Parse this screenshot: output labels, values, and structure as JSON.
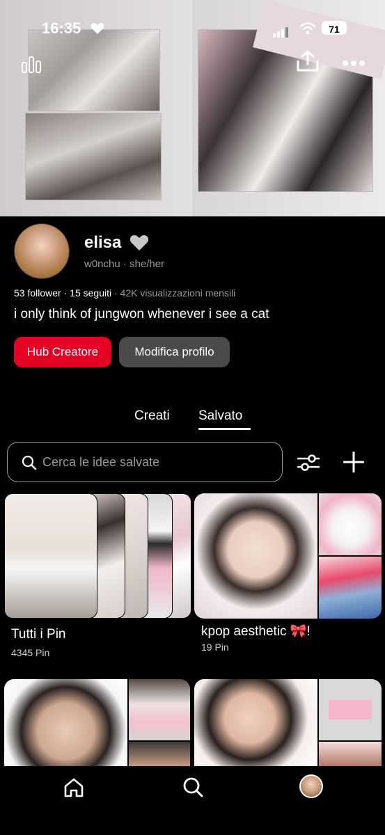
{
  "status_bar": {
    "time": "16:35",
    "battery": "71"
  },
  "profile": {
    "name": "elisa",
    "handle": "w0nchu · she/her",
    "followers": "53 follower",
    "following": "15 seguiti",
    "views": "42K visualizzazioni mensili",
    "bio": "i only think of jungwon whenever i see a cat",
    "hub_button": "Hub Creatore",
    "edit_button": "Modifica profilo"
  },
  "tabs": [
    {
      "label": "Creati",
      "active": false
    },
    {
      "label": "Salvato",
      "active": true
    }
  ],
  "search": {
    "placeholder": "Cerca le idee salvate"
  },
  "boards": [
    {
      "title": "Tutti i Pin",
      "count": "4345 Pin"
    },
    {
      "title": "kpop aesthetic 🎀!",
      "count": "19 Pin"
    }
  ],
  "icons": {
    "top_left": "stats-icon",
    "top_share": "share-icon",
    "top_more": "more-icon",
    "filter": "filter-icon",
    "add": "plus-icon",
    "nav": [
      "home-icon",
      "search-icon",
      "profile-avatar"
    ]
  },
  "colors": {
    "accent": "#e60023",
    "secondary_button": "#4a4a48",
    "background": "#000000"
  }
}
